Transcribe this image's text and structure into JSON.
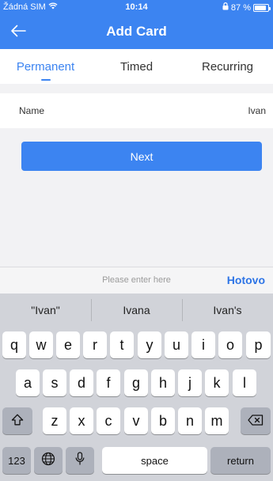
{
  "status": {
    "carrier": "Žádná SIM",
    "time": "10:14",
    "battery_text": "87 %",
    "battery_level": 0.87
  },
  "nav": {
    "title": "Add Card"
  },
  "tabs": [
    {
      "label": "Permanent"
    },
    {
      "label": "Timed"
    },
    {
      "label": "Recurring"
    }
  ],
  "form": {
    "name_label": "Name",
    "name_value": "Ivan"
  },
  "next_button": "Next",
  "keyboard_toolbar": {
    "placeholder": "Please enter here",
    "done": "Hotovo"
  },
  "suggestions": [
    "\"Ivan\"",
    "Ivana",
    "Ivan's"
  ],
  "keys": {
    "row1": [
      "q",
      "w",
      "e",
      "r",
      "t",
      "y",
      "u",
      "i",
      "o",
      "p"
    ],
    "row2": [
      "a",
      "s",
      "d",
      "f",
      "g",
      "h",
      "j",
      "k",
      "l"
    ],
    "row3": [
      "z",
      "x",
      "c",
      "v",
      "b",
      "n",
      "m"
    ],
    "numbers": "123",
    "space": "space",
    "return": "return"
  }
}
